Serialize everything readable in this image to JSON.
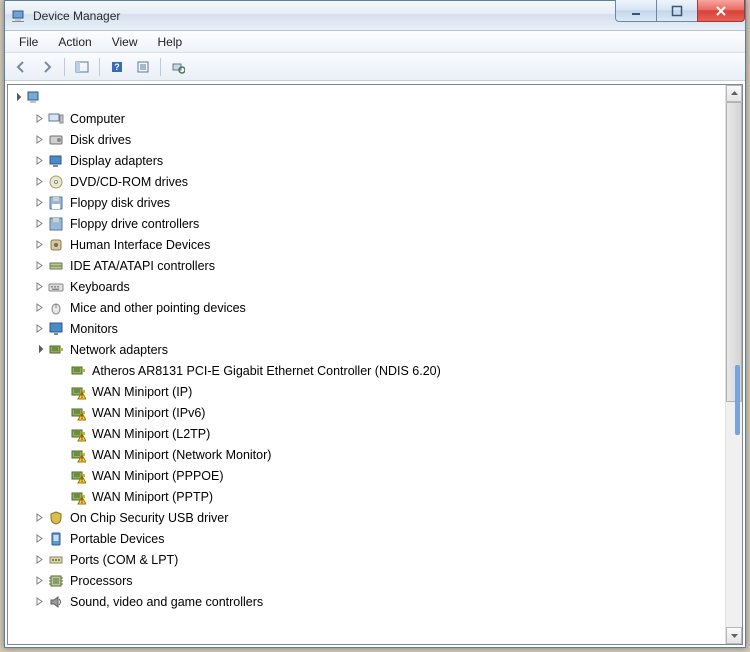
{
  "window": {
    "title": "Device Manager"
  },
  "menu": {
    "file": "File",
    "action": "Action",
    "view": "View",
    "help": "Help"
  },
  "tree": {
    "root_expanded": true,
    "categories": [
      {
        "label": "Computer",
        "expanded": false,
        "icon": "computer-icon"
      },
      {
        "label": "Disk drives",
        "expanded": false,
        "icon": "disk-icon"
      },
      {
        "label": "Display adapters",
        "expanded": false,
        "icon": "display-icon"
      },
      {
        "label": "DVD/CD-ROM drives",
        "expanded": false,
        "icon": "dvd-icon"
      },
      {
        "label": "Floppy disk drives",
        "expanded": false,
        "icon": "floppy-icon"
      },
      {
        "label": "Floppy drive controllers",
        "expanded": false,
        "icon": "floppy-ctrl-icon"
      },
      {
        "label": "Human Interface Devices",
        "expanded": false,
        "icon": "hid-icon"
      },
      {
        "label": "IDE ATA/ATAPI controllers",
        "expanded": false,
        "icon": "ide-icon"
      },
      {
        "label": "Keyboards",
        "expanded": false,
        "icon": "keyboard-icon"
      },
      {
        "label": "Mice and other pointing devices",
        "expanded": false,
        "icon": "mouse-icon"
      },
      {
        "label": "Monitors",
        "expanded": false,
        "icon": "monitor-icon"
      },
      {
        "label": "Network adapters",
        "expanded": true,
        "icon": "network-icon",
        "children": [
          {
            "label": "Atheros AR8131 PCI-E Gigabit Ethernet Controller (NDIS 6.20)",
            "icon": "nic-icon",
            "warn": false
          },
          {
            "label": "WAN Miniport (IP)",
            "icon": "nic-icon",
            "warn": true
          },
          {
            "label": "WAN Miniport (IPv6)",
            "icon": "nic-icon",
            "warn": true
          },
          {
            "label": "WAN Miniport (L2TP)",
            "icon": "nic-icon",
            "warn": true
          },
          {
            "label": "WAN Miniport (Network Monitor)",
            "icon": "nic-icon",
            "warn": true
          },
          {
            "label": "WAN Miniport (PPPOE)",
            "icon": "nic-icon",
            "warn": true
          },
          {
            "label": "WAN Miniport (PPTP)",
            "icon": "nic-icon",
            "warn": true
          }
        ]
      },
      {
        "label": "On Chip Security USB driver",
        "expanded": false,
        "icon": "security-icon"
      },
      {
        "label": "Portable Devices",
        "expanded": false,
        "icon": "portable-icon"
      },
      {
        "label": "Ports (COM & LPT)",
        "expanded": false,
        "icon": "port-icon"
      },
      {
        "label": "Processors",
        "expanded": false,
        "icon": "cpu-icon"
      },
      {
        "label": "Sound, video and game controllers",
        "expanded": false,
        "icon": "sound-icon"
      }
    ]
  }
}
